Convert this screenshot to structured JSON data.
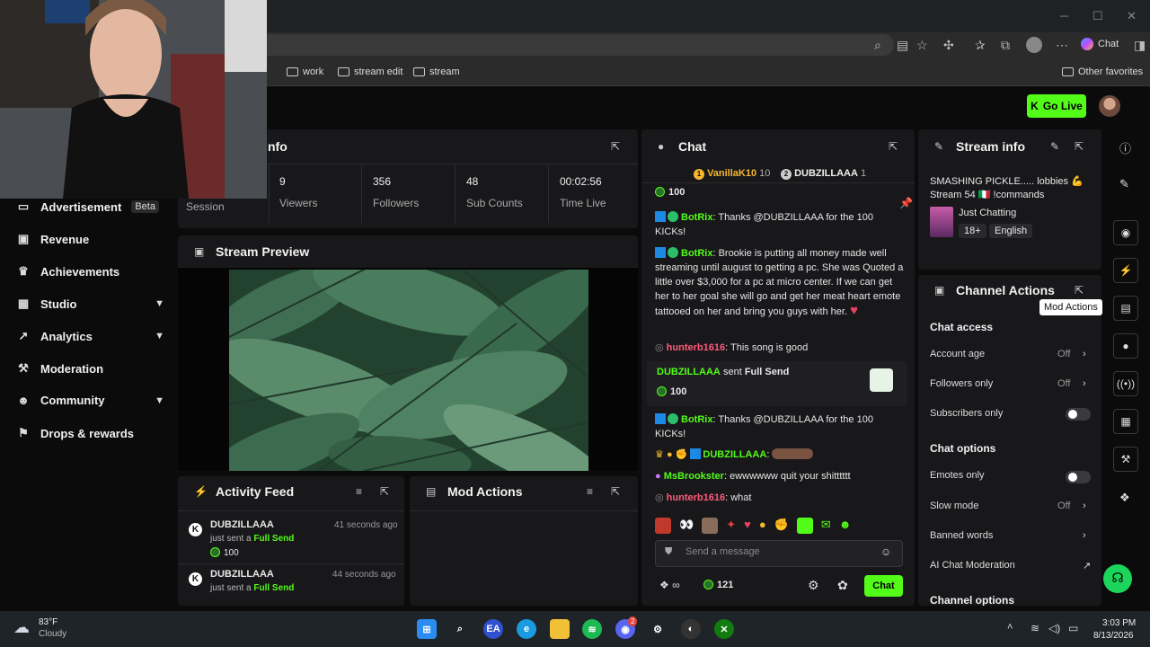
{
  "browser": {
    "bookmarks": [
      "s",
      "work",
      "stream edit",
      "stream"
    ],
    "other_favorites": "Other favorites",
    "copilot_label": "Chat"
  },
  "header": {
    "go_live": "Go Live"
  },
  "sidebar": {
    "items": [
      {
        "label": "Session",
        "icon": "clock-icon"
      },
      {
        "label": "Advertisement",
        "badge": "Beta",
        "icon": "tv-icon"
      },
      {
        "label": "Revenue",
        "icon": "wallet-icon"
      },
      {
        "label": "Achievements",
        "icon": "trophy-icon"
      },
      {
        "label": "Studio",
        "icon": "studio-icon",
        "expandable": true
      },
      {
        "label": "Analytics",
        "icon": "chart-icon",
        "expandable": true
      },
      {
        "label": "Moderation",
        "icon": "hammer-icon"
      },
      {
        "label": "Community",
        "icon": "people-icon",
        "expandable": true
      },
      {
        "label": "Drops & rewards",
        "icon": "gift-icon"
      }
    ]
  },
  "session_info": {
    "title_fragment": "nfo",
    "stats": [
      {
        "value": "9",
        "label": "Viewers"
      },
      {
        "value": "356",
        "label": "Followers"
      },
      {
        "value": "48",
        "label": "Sub Counts"
      },
      {
        "value": "00:02:56",
        "label": "Time Live"
      }
    ]
  },
  "preview": {
    "title": "Stream Preview"
  },
  "activity": {
    "title": "Activity Feed",
    "items": [
      {
        "user": "DUBZILLAAA",
        "time": "41 seconds ago",
        "action": "just sent a",
        "item": "Full Send",
        "amount": "100"
      },
      {
        "user": "DUBZILLAAA",
        "time": "44 seconds ago",
        "action": "just sent a",
        "item": "Full Send",
        "amount": "100"
      }
    ]
  },
  "mod_actions": {
    "title": "Mod Actions"
  },
  "chat": {
    "title": "Chat",
    "pinned": [
      {
        "user": "VanillaK10",
        "count": "10"
      },
      {
        "user": "DUBZILLAAA",
        "count": "1"
      }
    ],
    "top_amount": "100",
    "messages": [
      {
        "user": "BotRix",
        "text": ": Thanks @DUBZILLAAA for the 100 KICKs!"
      },
      {
        "user": "BotRix",
        "text": ": Brookie is putting all money made well streaming until august to getting a pc. She was Quoted a little over $3,000 for a pc at micro center. If we can get her to her goal she will go and get her meat heart emote tattooed on her and bring you guys with her."
      },
      {
        "user": "hunterb1616",
        "text": ": This song is good"
      },
      {
        "user": "BotRix",
        "text": ": Thanks @DUBZILLAAA for the 100 KICKs!"
      },
      {
        "user": "DUBZILLAAA",
        "text": ":"
      },
      {
        "user": "MsBrookster",
        "text": ": ewwwwww quit your shitttttt"
      },
      {
        "user": "hunterb1616",
        "text": ": what"
      }
    ],
    "gift_card": {
      "user": "DUBZILLAAA",
      "action": "sent",
      "item": "Full Send",
      "amount": "100"
    },
    "input_placeholder": "Send a message",
    "balance": "121",
    "send_label": "Chat"
  },
  "stream_info": {
    "title": "Stream info",
    "stream_title": "SMASHING PICKLE..... lobbies 💪 Stream 54 🇮🇹 !commands",
    "category": "Just Chatting",
    "tags": [
      "18+",
      "English"
    ]
  },
  "channel_actions": {
    "title": "Channel Actions",
    "chat_access": "Chat access",
    "account_age": {
      "label": "Account age",
      "value": "Off"
    },
    "followers_only": {
      "label": "Followers only",
      "value": "Off"
    },
    "subscribers_only": "Subscribers only",
    "chat_options": "Chat options",
    "emotes_only": "Emotes only",
    "slow_mode": {
      "label": "Slow mode",
      "value": "Off"
    },
    "banned_words": "Banned words",
    "ai_moderation": "AI Chat Moderation",
    "channel_options": "Channel options"
  },
  "rail": {
    "tooltip": "Mod Actions"
  },
  "taskbar": {
    "weather_temp": "83°F",
    "weather_desc": "Cloudy",
    "time": "3:03 PM",
    "date": "8/13/2026",
    "discord_badge": "2"
  },
  "colors": {
    "accent": "#53fc18",
    "panel": "#18181b",
    "background": "#0b0b0c"
  }
}
